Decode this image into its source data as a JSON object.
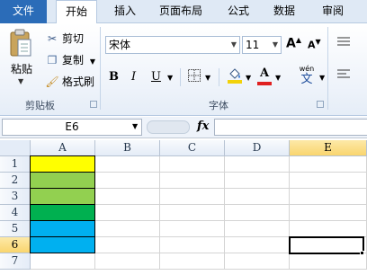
{
  "tabs": {
    "file": "文件",
    "home": "开始",
    "insert": "插入",
    "page_layout": "页面布局",
    "formulas": "公式",
    "data": "数据",
    "review": "审阅"
  },
  "clipboard": {
    "paste": "粘贴",
    "cut": "剪切",
    "copy": "复制",
    "format_painter": "格式刷",
    "group_label": "剪贴板"
  },
  "font": {
    "name": "宋体",
    "size": "11",
    "group_label": "字体",
    "bold": "B",
    "italic": "I",
    "underline": "U",
    "phonetic": "wén",
    "phonetic_char": "文",
    "font_color_letter": "A",
    "grow": "A",
    "shrink": "A",
    "font_color": "#e02020",
    "fill_color": "#f2d20a"
  },
  "formula_bar": {
    "name_box": "E6",
    "fx": "fx",
    "value": ""
  },
  "sheet": {
    "columns": [
      "A",
      "B",
      "C",
      "D",
      "E"
    ],
    "rows": [
      "1",
      "2",
      "3",
      "4",
      "5",
      "6",
      "7"
    ],
    "selected_column": "E",
    "selected_row": "6",
    "active_cell": "E6",
    "column_a_fills": [
      "#ffff00",
      "#92d050",
      "#92d050",
      "#00b050",
      "#00b0f0",
      "#00b0f0"
    ]
  }
}
